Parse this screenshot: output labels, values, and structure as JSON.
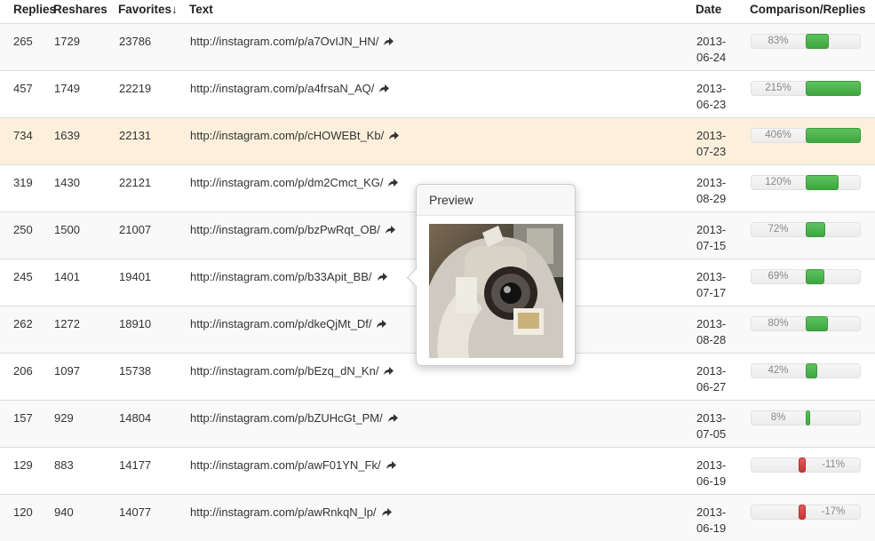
{
  "headers": {
    "replies": "Replies",
    "reshares": "Reshares",
    "favorites": "Favorites↓",
    "text": "Text",
    "date": "Date",
    "comparison": "Comparison/Replies"
  },
  "icons": {
    "share": "share-arrow-icon"
  },
  "colors": {
    "positive": "#4cb34c",
    "negative": "#d64545",
    "highlight_row": "#fcf0dc"
  },
  "rows": [
    {
      "replies": "265",
      "reshares": "1729",
      "favorites": "23786",
      "text": "http://instagram.com/p/a7OvIJN_HN/",
      "date_y": "2013-",
      "date_md": "06-24",
      "pct_label": "83%",
      "pct": 83
    },
    {
      "replies": "457",
      "reshares": "1749",
      "favorites": "22219",
      "text": "http://instagram.com/p/a4frsaN_AQ/",
      "date_y": "2013-",
      "date_md": "06-23",
      "pct_label": "215%",
      "pct": 215
    },
    {
      "replies": "734",
      "reshares": "1639",
      "favorites": "22131",
      "text": "http://instagram.com/p/cHOWEBt_Kb/",
      "date_y": "2013-",
      "date_md": "07-23",
      "pct_label": "406%",
      "pct": 406
    },
    {
      "replies": "319",
      "reshares": "1430",
      "favorites": "22121",
      "text": "http://instagram.com/p/dm2Cmct_KG/",
      "date_y": "2013-",
      "date_md": "08-29",
      "pct_label": "120%",
      "pct": 120
    },
    {
      "replies": "250",
      "reshares": "1500",
      "favorites": "21007",
      "text": "http://instagram.com/p/bzPwRqt_OB/",
      "date_y": "2013-",
      "date_md": "07-15",
      "pct_label": "72%",
      "pct": 72
    },
    {
      "replies": "245",
      "reshares": "1401",
      "favorites": "19401",
      "text": "http://instagram.com/p/b33Apit_BB/",
      "date_y": "2013-",
      "date_md": "07-17",
      "pct_label": "69%",
      "pct": 69
    },
    {
      "replies": "262",
      "reshares": "1272",
      "favorites": "18910",
      "text": "http://instagram.com/p/dkeQjMt_Df/",
      "date_y": "2013-",
      "date_md": "08-28",
      "pct_label": "80%",
      "pct": 80
    },
    {
      "replies": "206",
      "reshares": "1097",
      "favorites": "15738",
      "text": "http://instagram.com/p/bEzq_dN_Kn/",
      "date_y": "2013-",
      "date_md": "06-27",
      "pct_label": "42%",
      "pct": 42
    },
    {
      "replies": "157",
      "reshares": "929",
      "favorites": "14804",
      "text": "http://instagram.com/p/bZUHcGt_PM/",
      "date_y": "2013-",
      "date_md": "07-05",
      "pct_label": "8%",
      "pct": 8
    },
    {
      "replies": "129",
      "reshares": "883",
      "favorites": "14177",
      "text": "http://instagram.com/p/awF01YN_Fk/",
      "date_y": "2013-",
      "date_md": "06-19",
      "pct_label": "-11%",
      "pct": -11
    },
    {
      "replies": "120",
      "reshares": "940",
      "favorites": "14077",
      "text": "http://instagram.com/p/awRnkqN_lp/",
      "date_y": "2013-",
      "date_md": "06-19",
      "pct_label": "-17%",
      "pct": -17
    }
  ],
  "highlighted_row": 2,
  "popover": {
    "title": "Preview",
    "image_icon": "astronaut-photo-icon"
  }
}
